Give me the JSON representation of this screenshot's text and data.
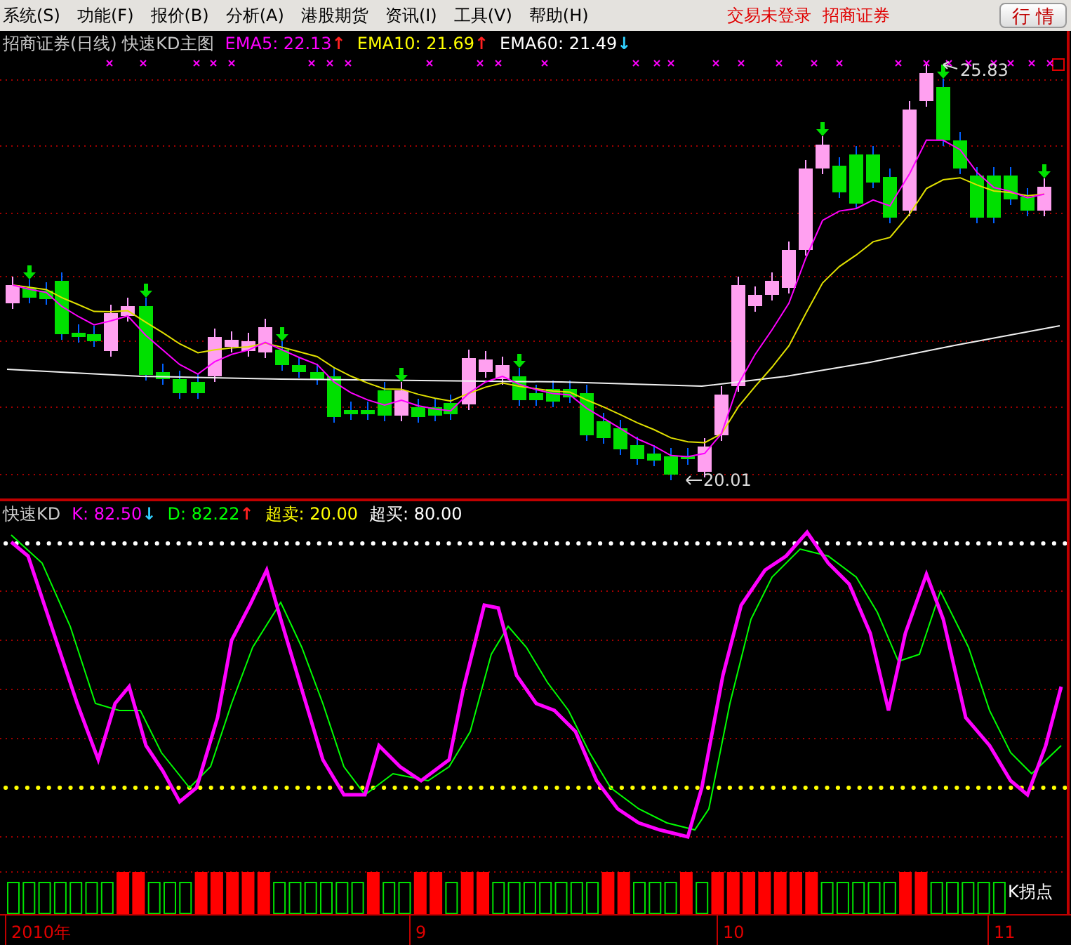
{
  "menu": [
    {
      "label": "系统(S)"
    },
    {
      "label": "功能(F)"
    },
    {
      "label": "报价(B)"
    },
    {
      "label": "分析(A)"
    },
    {
      "label": "港股期货"
    },
    {
      "label": "资讯(I)"
    },
    {
      "label": "工具(V)"
    },
    {
      "label": "帮助(H)"
    }
  ],
  "status": [
    "交易未登录",
    "招商证券"
  ],
  "quote_button": "行 情",
  "main_panel": {
    "title": "招商证券(日线) 快速KD主图",
    "indicators": [
      {
        "label": "EMA5: 22.13",
        "arrow": {
          "text": "↑",
          "color": "#ff2020"
        },
        "color": "#ff00ff"
      },
      {
        "label": "EMA10: 21.69",
        "arrow": {
          "text": "↑",
          "color": "#ff2020"
        },
        "color": "#ffff00"
      },
      {
        "label": "EMA60: 21.49",
        "arrow": {
          "text": "↓",
          "color": "#30d0ff"
        },
        "color": "#ffffff"
      }
    ],
    "high_label": "25.83",
    "low_label": "20.01"
  },
  "kd_panel": {
    "title": "快速KD",
    "indicators": [
      {
        "label": "K: 82.50",
        "arrow": {
          "text": "↓",
          "color": "#30d0ff"
        },
        "color": "#ff00ff"
      },
      {
        "label": "D: 82.22",
        "arrow": {
          "text": "↑",
          "color": "#ff2020"
        },
        "color": "#00ff00"
      },
      {
        "label": "超卖: 20.00",
        "color": "#ffff00"
      },
      {
        "label": "超买: 80.00",
        "color": "#ffffff"
      }
    ],
    "strip_label": "K拐点"
  },
  "time_axis": [
    "2010年",
    "9",
    "10",
    "11"
  ]
}
